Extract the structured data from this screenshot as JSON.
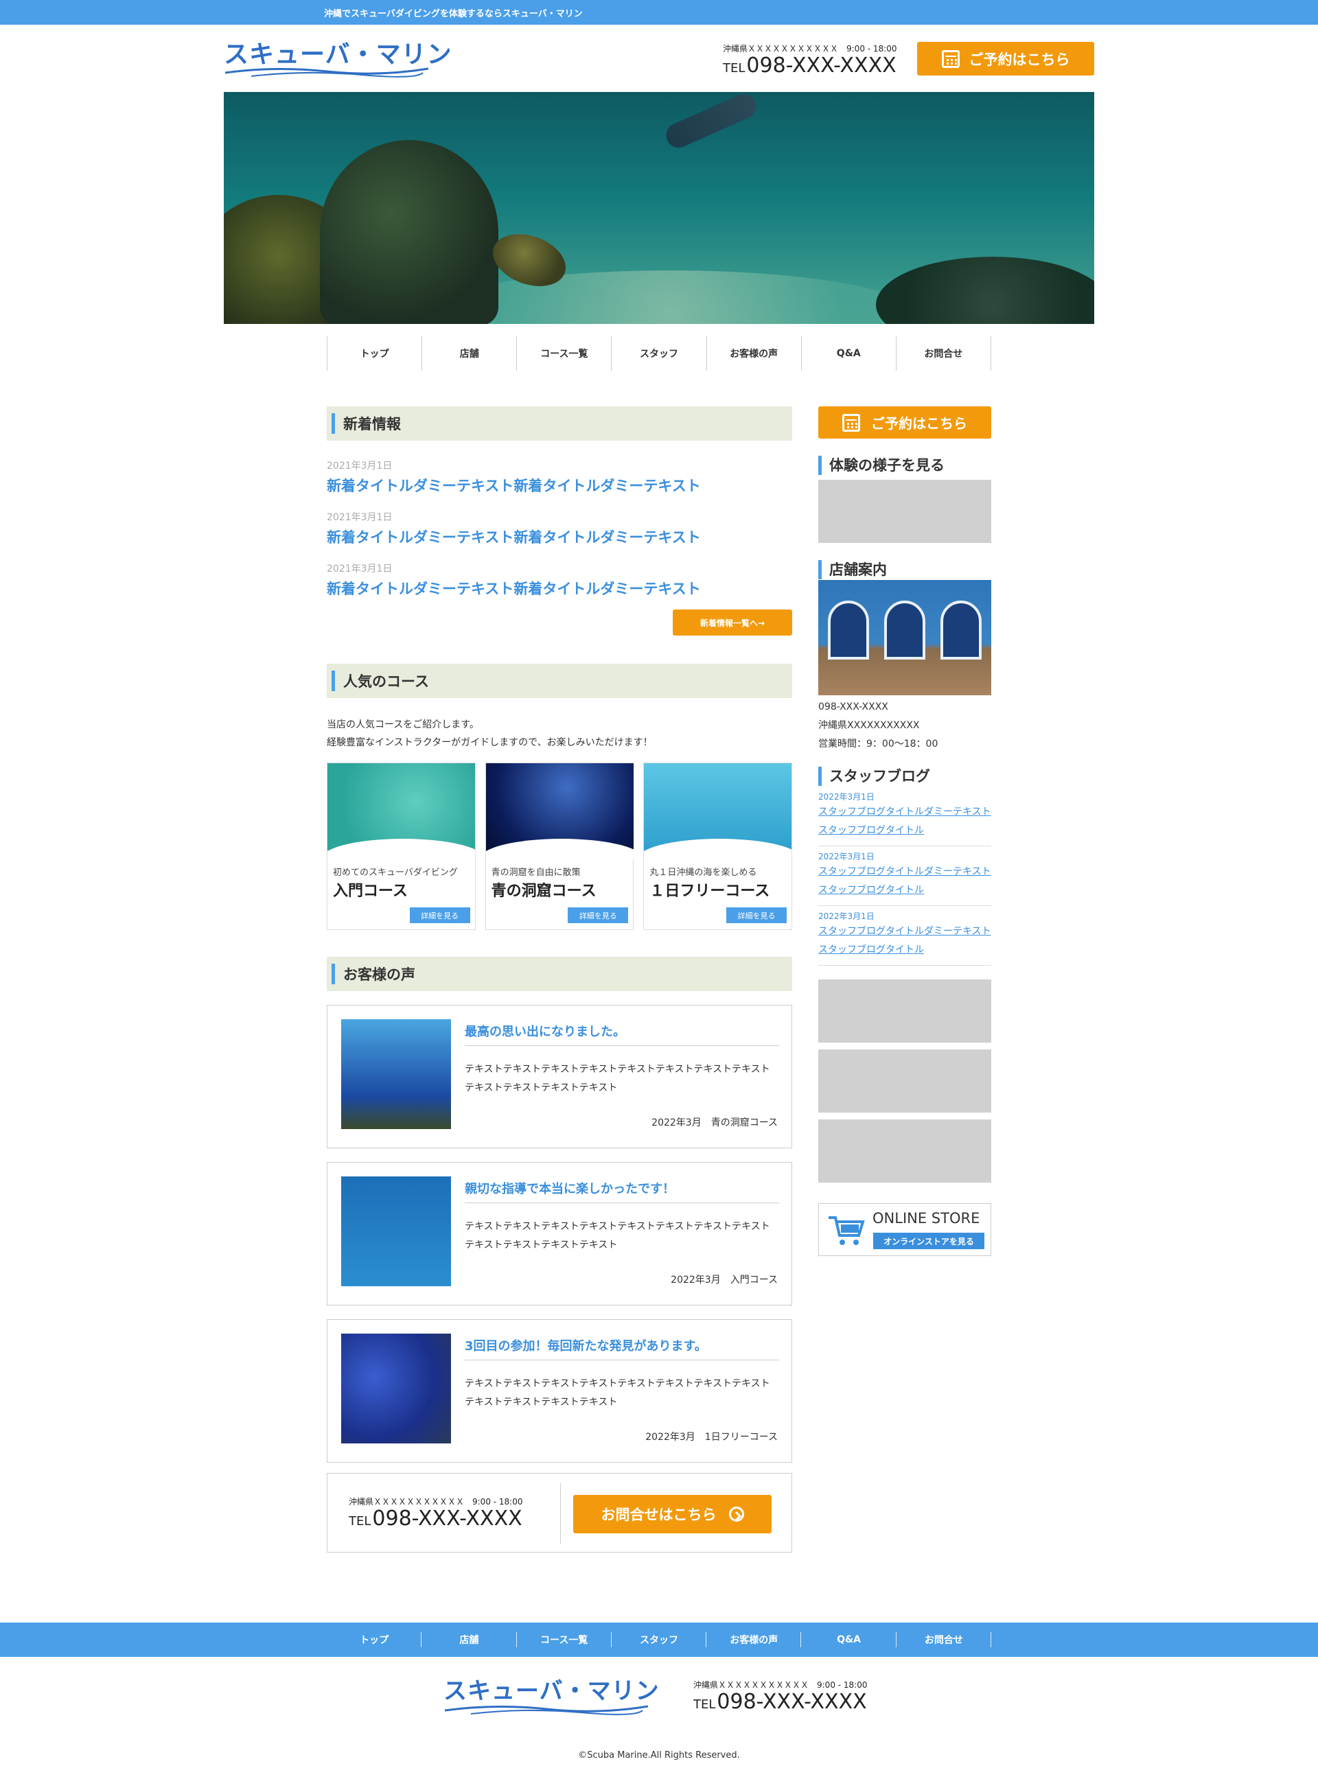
{
  "topbar": {
    "text": "沖縄でスキューバダイビングを体験するならスキューバ・マリン"
  },
  "brand": {
    "logo": "スキューバ・マリン",
    "accent": "#4a9fe8",
    "orange": "#f39a0c",
    "logo_color": "#2f6ec4"
  },
  "header": {
    "address": "沖縄県ＸＸＸＸＸＸＸＸＸＸＸ　9:00 - 18:00",
    "tel_prefix": "TEL",
    "tel": "098-XXX-XXXX",
    "reserve_label": "ご予約はこちら",
    "reserve_icon": "calendar-icon"
  },
  "gnav": [
    "トップ",
    "店舗",
    "コース一覧",
    "スタッフ",
    "お客様の声",
    "Q&A",
    "お問合せ"
  ],
  "news": {
    "heading": "新着情報",
    "items": [
      {
        "date": "2021年3月1日",
        "title": "新着タイトルダミーテキスト新着タイトルダミーテキスト"
      },
      {
        "date": "2021年3月1日",
        "title": "新着タイトルダミーテキスト新着タイトルダミーテキスト"
      },
      {
        "date": "2021年3月1日",
        "title": "新着タイトルダミーテキスト新着タイトルダミーテキスト"
      }
    ],
    "more_label": "新着情報一覧へ→"
  },
  "courses": {
    "heading": "人気のコース",
    "lead1": "当店の人気コースをご紹介します。",
    "lead2": "経験豊富なインストラクターがガイドしますので、お楽しみいただけます！",
    "items": [
      {
        "sub": "初めてのスキューバダイビング",
        "name": "入門コース",
        "more": "詳細を見る"
      },
      {
        "sub": "青の洞窟を自由に散策",
        "name": "青の洞窟コース",
        "more": "詳細を見る"
      },
      {
        "sub": "丸１日沖縄の海を楽しめる",
        "name": "１日フリーコース",
        "more": "詳細を見る"
      }
    ]
  },
  "voices": {
    "heading": "お客様の声",
    "items": [
      {
        "title": "最高の思い出になりました。",
        "body": "テキストテキストテキストテキストテキストテキストテキストテキストテキストテキストテキストテキスト",
        "meta": "2022年3月　青の洞窟コース"
      },
      {
        "title": "親切な指導で本当に楽しかったです！",
        "body": "テキストテキストテキストテキストテキストテキストテキストテキストテキストテキストテキストテキスト",
        "meta": "2022年3月　入門コース"
      },
      {
        "title": "3回目の参加！毎回新たな発見があります。",
        "body": "テキストテキストテキストテキストテキストテキストテキストテキストテキストテキストテキストテキスト",
        "meta": "2022年3月　1日フリーコース"
      }
    ]
  },
  "contact_box": {
    "address": "沖縄県ＸＸＸＸＸＸＸＸＸＸＸ　9:00 - 18:00",
    "tel_prefix": "TEL",
    "tel": "098-XXX-XXXX",
    "button": "お問合せはこちら",
    "button_icon": "arrow-circle-icon"
  },
  "sidebar": {
    "reserve_label": "ご予約はこちら",
    "experience_heading": "体験の様子を見る",
    "shop_heading": "店舗案内",
    "shop_tel": "098-XXX-XXXX",
    "shop_address": "沖縄県XXXXXXXXXXX",
    "shop_hours": "営業時間：9：00〜18：00",
    "blog_heading": "スタッフブログ",
    "blog": [
      {
        "date": "2022年3月1日",
        "title": "スタッフブログタイトルダミーテキストスタッフブログタイトル"
      },
      {
        "date": "2022年3月1日",
        "title": "スタッフブログタイトルダミーテキストスタッフブログタイトル"
      },
      {
        "date": "2022年3月1日",
        "title": "スタッフブログタイトルダミーテキストスタッフブログタイトル"
      }
    ],
    "store_label": "ONLINE STORE",
    "store_button": "オンラインストアを見る"
  },
  "footer": {
    "nav": [
      "トップ",
      "店舗",
      "コース一覧",
      "スタッフ",
      "お客様の声",
      "Q&A",
      "お問合せ"
    ],
    "logo": "スキューバ・マリン",
    "address": "沖縄県ＸＸＸＸＸＸＸＸＸＸＸ　9:00 - 18:00",
    "tel_prefix": "TEL",
    "tel": "098-XXX-XXXX",
    "copyright": "©Scuba Marine.All Rights Reserved."
  }
}
